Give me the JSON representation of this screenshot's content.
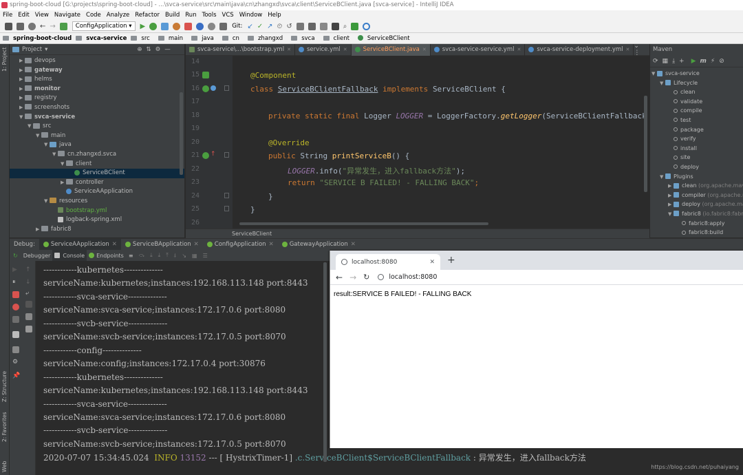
{
  "window": {
    "title": "spring-boot-cloud [G:\\projects\\spring-boot-cloud] - ...\\svca-service\\src\\main\\java\\cn\\zhangxd\\svca\\client\\ServiceBClient.java [svca-service] - IntelliJ IDEA"
  },
  "menu": [
    "File",
    "Edit",
    "View",
    "Navigate",
    "Code",
    "Analyze",
    "Refactor",
    "Build",
    "Run",
    "Tools",
    "VCS",
    "Window",
    "Help"
  ],
  "toolbar": {
    "run_config": "ConfigApplication",
    "git_label": "Git:"
  },
  "navbar": [
    "spring-boot-cloud",
    "svca-service",
    "src",
    "main",
    "java",
    "cn",
    "zhangxd",
    "svca",
    "client",
    "ServiceBClient"
  ],
  "left_strip": {
    "project": "1: Project",
    "structure": "Z: Structure",
    "favorites": "2: Favorites",
    "web": "Web"
  },
  "project": {
    "title": "Project",
    "tree": [
      {
        "label": "devops",
        "indent": 0,
        "arrow": "▶",
        "icon": "folder",
        "bold": false
      },
      {
        "label": "gateway",
        "indent": 0,
        "arrow": "▶",
        "icon": "folder",
        "bold": true
      },
      {
        "label": "helms",
        "indent": 0,
        "arrow": "▶",
        "icon": "folder",
        "bold": false
      },
      {
        "label": "monitor",
        "indent": 0,
        "arrow": "▶",
        "icon": "folder",
        "bold": true
      },
      {
        "label": "registry",
        "indent": 0,
        "arrow": "▶",
        "icon": "folder",
        "bold": false
      },
      {
        "label": "screenshots",
        "indent": 0,
        "arrow": "▶",
        "icon": "folder",
        "bold": false
      },
      {
        "label": "svca-service",
        "indent": 0,
        "arrow": "▼",
        "icon": "folder",
        "bold": true
      },
      {
        "label": "src",
        "indent": 1,
        "arrow": "▼",
        "icon": "folder",
        "bold": false
      },
      {
        "label": "main",
        "indent": 2,
        "arrow": "▼",
        "icon": "folder",
        "bold": false
      },
      {
        "label": "java",
        "indent": 3,
        "arrow": "▼",
        "icon": "blue",
        "bold": false
      },
      {
        "label": "cn.zhangxd.svca",
        "indent": 4,
        "arrow": "▼",
        "icon": "folder",
        "bold": false
      },
      {
        "label": "client",
        "indent": 5,
        "arrow": "▼",
        "icon": "folder",
        "bold": false
      },
      {
        "label": "ServiceBClient",
        "indent": 6,
        "arrow": "",
        "icon": "class",
        "bold": false,
        "selected": true
      },
      {
        "label": "controller",
        "indent": 5,
        "arrow": "▶",
        "icon": "folder",
        "bold": false
      },
      {
        "label": "ServiceAApplication",
        "indent": 5,
        "arrow": "",
        "icon": "classblue",
        "bold": false
      },
      {
        "label": "resources",
        "indent": 3,
        "arrow": "▼",
        "icon": "orange",
        "bold": false
      },
      {
        "label": "bootstrap.yml",
        "indent": 4,
        "arrow": "",
        "icon": "yml",
        "bold": false,
        "green": true
      },
      {
        "label": "logback-spring.xml",
        "indent": 4,
        "arrow": "",
        "icon": "xml",
        "bold": false
      },
      {
        "label": "fabric8",
        "indent": 2,
        "arrow": "▶",
        "icon": "folder",
        "bold": false
      }
    ]
  },
  "editor_tabs": [
    {
      "label": "svca-service\\...\\bootstrap.yml",
      "active": false
    },
    {
      "label": "service.yml",
      "active": false
    },
    {
      "label": "ServiceBClient.java",
      "active": true
    },
    {
      "label": "svca-service-service.yml",
      "active": false
    },
    {
      "label": "svca-service-deployment.yml",
      "active": false
    }
  ],
  "code": {
    "line_numbers": [
      "14",
      "15",
      "16",
      "17",
      "18",
      "19",
      "20",
      "21",
      "22",
      "23",
      "24",
      "25",
      "26"
    ],
    "l15_annotation": "@Component",
    "l16_kw1": "class ",
    "l16_name": "ServiceBClientFallback",
    "l16_kw2": " implements ",
    "l16_rest": "ServiceBClient {",
    "l18_kw": "private static final ",
    "l18_type": "Logger ",
    "l18_const": "LOGGER",
    "l18_eq": " = LoggerFactory.",
    "l18_method": "getLogger",
    "l18_rest": "(ServiceBClientFallback",
    "l20_annotation": "@Override",
    "l21_kw": "public ",
    "l21_type": "String ",
    "l21_method": "printServiceB",
    "l21_rest": "() {",
    "l22_const": "LOGGER",
    "l22_call": ".info(",
    "l22_str": "\"异常发生，进入fallback方法\"",
    "l22_end": ");",
    "l23_kw": "return ",
    "l23_str": "\"SERVICE B FAILED! - FALLING BACK\"",
    "l23_end": ";",
    "l24": "}",
    "l25": "}",
    "breadcrumb": "ServiceBClient"
  },
  "maven": {
    "title": "Maven",
    "tree": [
      {
        "label": "svca-service",
        "indent": 0,
        "arrow": "▼",
        "extra": ""
      },
      {
        "label": "Lifecycle",
        "indent": 1,
        "arrow": "▼",
        "extra": ""
      },
      {
        "label": "clean",
        "indent": 2,
        "arrow": "",
        "extra": ""
      },
      {
        "label": "validate",
        "indent": 2,
        "arrow": "",
        "extra": ""
      },
      {
        "label": "compile",
        "indent": 2,
        "arrow": "",
        "extra": ""
      },
      {
        "label": "test",
        "indent": 2,
        "arrow": "",
        "extra": ""
      },
      {
        "label": "package",
        "indent": 2,
        "arrow": "",
        "extra": ""
      },
      {
        "label": "verify",
        "indent": 2,
        "arrow": "",
        "extra": ""
      },
      {
        "label": "install",
        "indent": 2,
        "arrow": "",
        "extra": ""
      },
      {
        "label": "site",
        "indent": 2,
        "arrow": "",
        "extra": ""
      },
      {
        "label": "deploy",
        "indent": 2,
        "arrow": "",
        "extra": ""
      },
      {
        "label": "Plugins",
        "indent": 1,
        "arrow": "▼",
        "extra": ""
      },
      {
        "label": "clean",
        "indent": 2,
        "arrow": "▶",
        "extra": " (org.apache.mave"
      },
      {
        "label": "compiler",
        "indent": 2,
        "arrow": "▶",
        "extra": " (org.apache.m"
      },
      {
        "label": "deploy",
        "indent": 2,
        "arrow": "▶",
        "extra": " (org.apache.ma"
      },
      {
        "label": "fabric8",
        "indent": 2,
        "arrow": "▼",
        "extra": " (io.fabric8:fabric"
      },
      {
        "label": "fabric8:apply",
        "indent": 3,
        "arrow": "",
        "extra": ""
      },
      {
        "label": "fabric8:build",
        "indent": 3,
        "arrow": "",
        "extra": ""
      }
    ]
  },
  "debug": {
    "label": "Debug:",
    "tabs": [
      "ServiceAApplication",
      "ServiceBApplication",
      "ConfigApplication",
      "GatewayApplication"
    ],
    "subtabs": [
      "Debugger",
      "Console",
      "Endpoints"
    ]
  },
  "console": {
    "lines": [
      "------------kubernetes--------------",
      "serviceName:kubernetes;instances:192.168.113.148 port:8443",
      "------------svca-service--------------",
      "serviceName:svca-service;instances:172.17.0.6 port:8080",
      "------------svcb-service--------------",
      "serviceName:svcb-service;instances:172.17.0.5 port:8070",
      "------------config--------------",
      "serviceName:config;instances:172.17.0.4 port:30876",
      "------------kubernetes--------------",
      "serviceName:kubernetes;instances:192.168.113.148 port:8443",
      "------------svca-service--------------",
      "serviceName:svca-service;instances:172.17.0.6 port:8080",
      "------------svcb-service--------------",
      "serviceName:svcb-service;instances:172.17.0.5 port:8070"
    ],
    "log_time": "2020-07-07 15:34:45.024",
    "log_level": "INFO",
    "log_pid": "13152",
    "log_sep": "--- [",
    "log_thread": " HystrixTimer-1]",
    "log_logger": ".c.ServiceBClient$ServiceBClientFallback",
    "log_msg": " : 异常发生，进入fallback方法"
  },
  "browser": {
    "tab_title": "localhost:8080",
    "address": "localhost:8080",
    "content": "result:SERVICE B FAILED! - FALLING BACK"
  },
  "watermark": "https://blog.csdn.net/puhaiyang"
}
